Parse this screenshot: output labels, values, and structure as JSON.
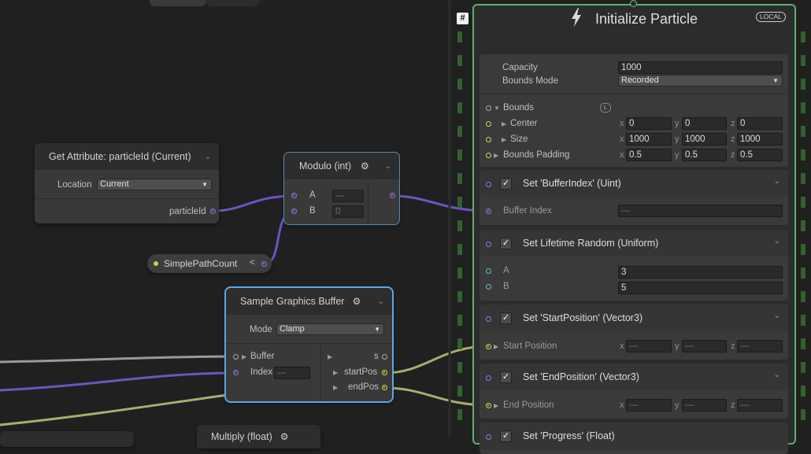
{
  "colors": {
    "background": "#202020",
    "node": "#393939",
    "selection": "#5aa7e6",
    "context_border": "#5fae6e",
    "int_wire": "#6b55c0",
    "float_wire": "#a9ad6b"
  },
  "get_attribute": {
    "title": "Get Attribute: particleId (Current)",
    "location_label": "Location",
    "location_value": "Current",
    "output_label": "particleId"
  },
  "modulo": {
    "title": "Modulo (int)",
    "input_a_label": "A",
    "input_a_value": "—",
    "input_b_label": "B",
    "input_b_value": "0"
  },
  "property": {
    "label": "SimplePathCount",
    "arrow": "<"
  },
  "sample_buffer": {
    "title": "Sample Graphics Buffer",
    "mode_label": "Mode",
    "mode_value": "Clamp",
    "buffer_label": "Buffer",
    "index_label": "Index",
    "index_value": "—",
    "out_s_label": "s",
    "out_start_label": "startPos",
    "out_end_label": "endPos"
  },
  "multiply": {
    "title": "Multiply (float)"
  },
  "context_header_label": "#",
  "init_context": {
    "title": "Initialize Particle",
    "space_badge": "LOCAL",
    "capacity_label": "Capacity",
    "capacity_value": "1000",
    "bounds_mode_label": "Bounds Mode",
    "bounds_mode_value": "Recorded",
    "bounds_label": "Bounds",
    "bounds_badge": "L",
    "center_label": "Center",
    "center": {
      "x": "0",
      "y": "0",
      "z": "0"
    },
    "size_label": "Size",
    "size": {
      "x": "1000",
      "y": "1000",
      "z": "1000"
    },
    "padding_label": "Bounds Padding",
    "padding": {
      "x": "0.5",
      "y": "0.5",
      "z": "0.5"
    },
    "axis_labels": {
      "x": "x",
      "y": "y",
      "z": "z"
    }
  },
  "blocks": {
    "buffer_index": {
      "title": "Set 'BufferIndex'  (Uint)",
      "field_label": "Buffer Index",
      "field_value": "—"
    },
    "lifetime": {
      "title": "Set Lifetime Random (Uniform)",
      "a_label": "A",
      "a_value": "3",
      "b_label": "B",
      "b_value": "5"
    },
    "start_position": {
      "title": "Set 'StartPosition'  (Vector3)",
      "field_label": "Start Position",
      "x": "—",
      "y": "—",
      "z": "—"
    },
    "end_position": {
      "title": "Set 'EndPosition'  (Vector3)",
      "field_label": "End Position",
      "x": "—",
      "y": "—",
      "z": "—"
    },
    "progress": {
      "title": "Set 'Progress'  (Float)"
    }
  },
  "icons": {
    "check": "✓",
    "chevron": "⌄",
    "bolt": "bolt-icon",
    "gear": "gear-icon"
  }
}
